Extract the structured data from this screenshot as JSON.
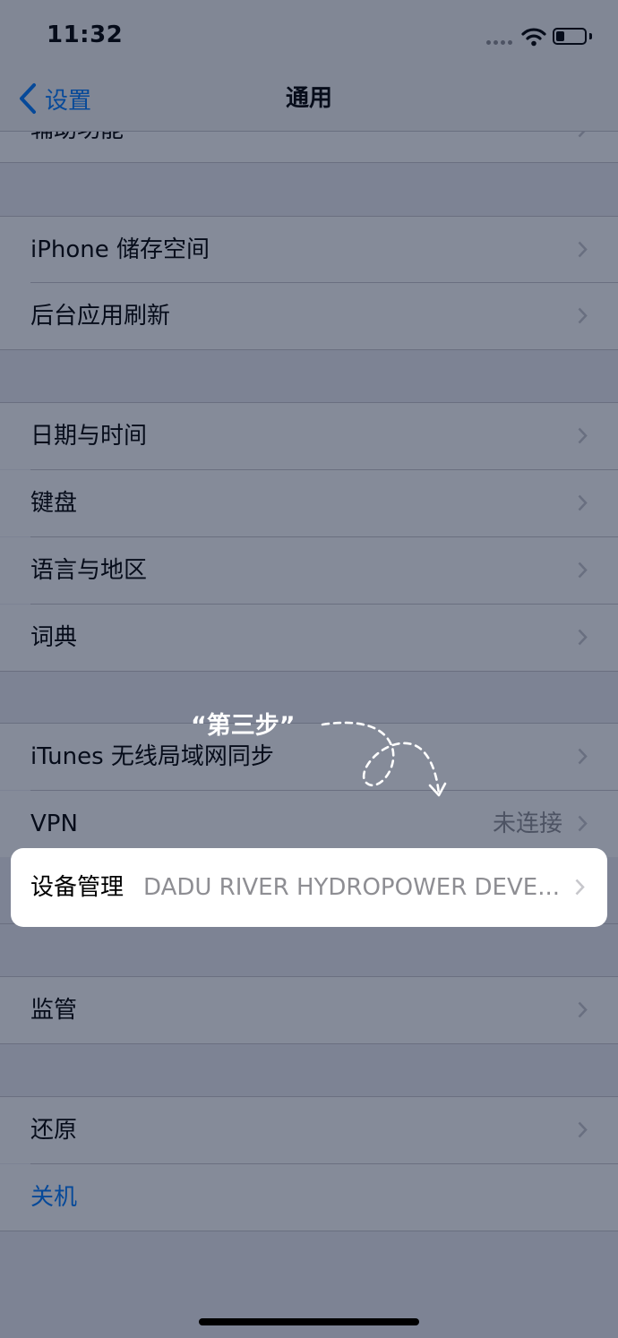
{
  "status": {
    "time": "11:32"
  },
  "nav": {
    "back_label": "设置",
    "title": "通用"
  },
  "groups": [
    {
      "items": [
        {
          "label": "辅助功能"
        }
      ]
    },
    {
      "items": [
        {
          "label": "iPhone 储存空间"
        },
        {
          "label": "后台应用刷新"
        }
      ]
    },
    {
      "items": [
        {
          "label": "日期与时间"
        },
        {
          "label": "键盘"
        },
        {
          "label": "语言与地区"
        },
        {
          "label": "词典"
        }
      ]
    },
    {
      "items": [
        {
          "label": "iTunes 无线局域网同步"
        },
        {
          "label": "VPN",
          "value": "未连接"
        },
        {
          "label": "设备管理",
          "value": "DADU RIVER HYDROPOWER DEVE..."
        }
      ]
    },
    {
      "items": [
        {
          "label": "监管"
        }
      ]
    },
    {
      "items": [
        {
          "label": "还原"
        },
        {
          "label": "关机"
        }
      ]
    }
  ],
  "annotation": {
    "step_text": "“第三步”"
  },
  "colors": {
    "accent": "#007aff",
    "background": "#efeff4",
    "separator": "#c8c7cc",
    "overlay": "rgba(12,24,52,0.5)"
  }
}
